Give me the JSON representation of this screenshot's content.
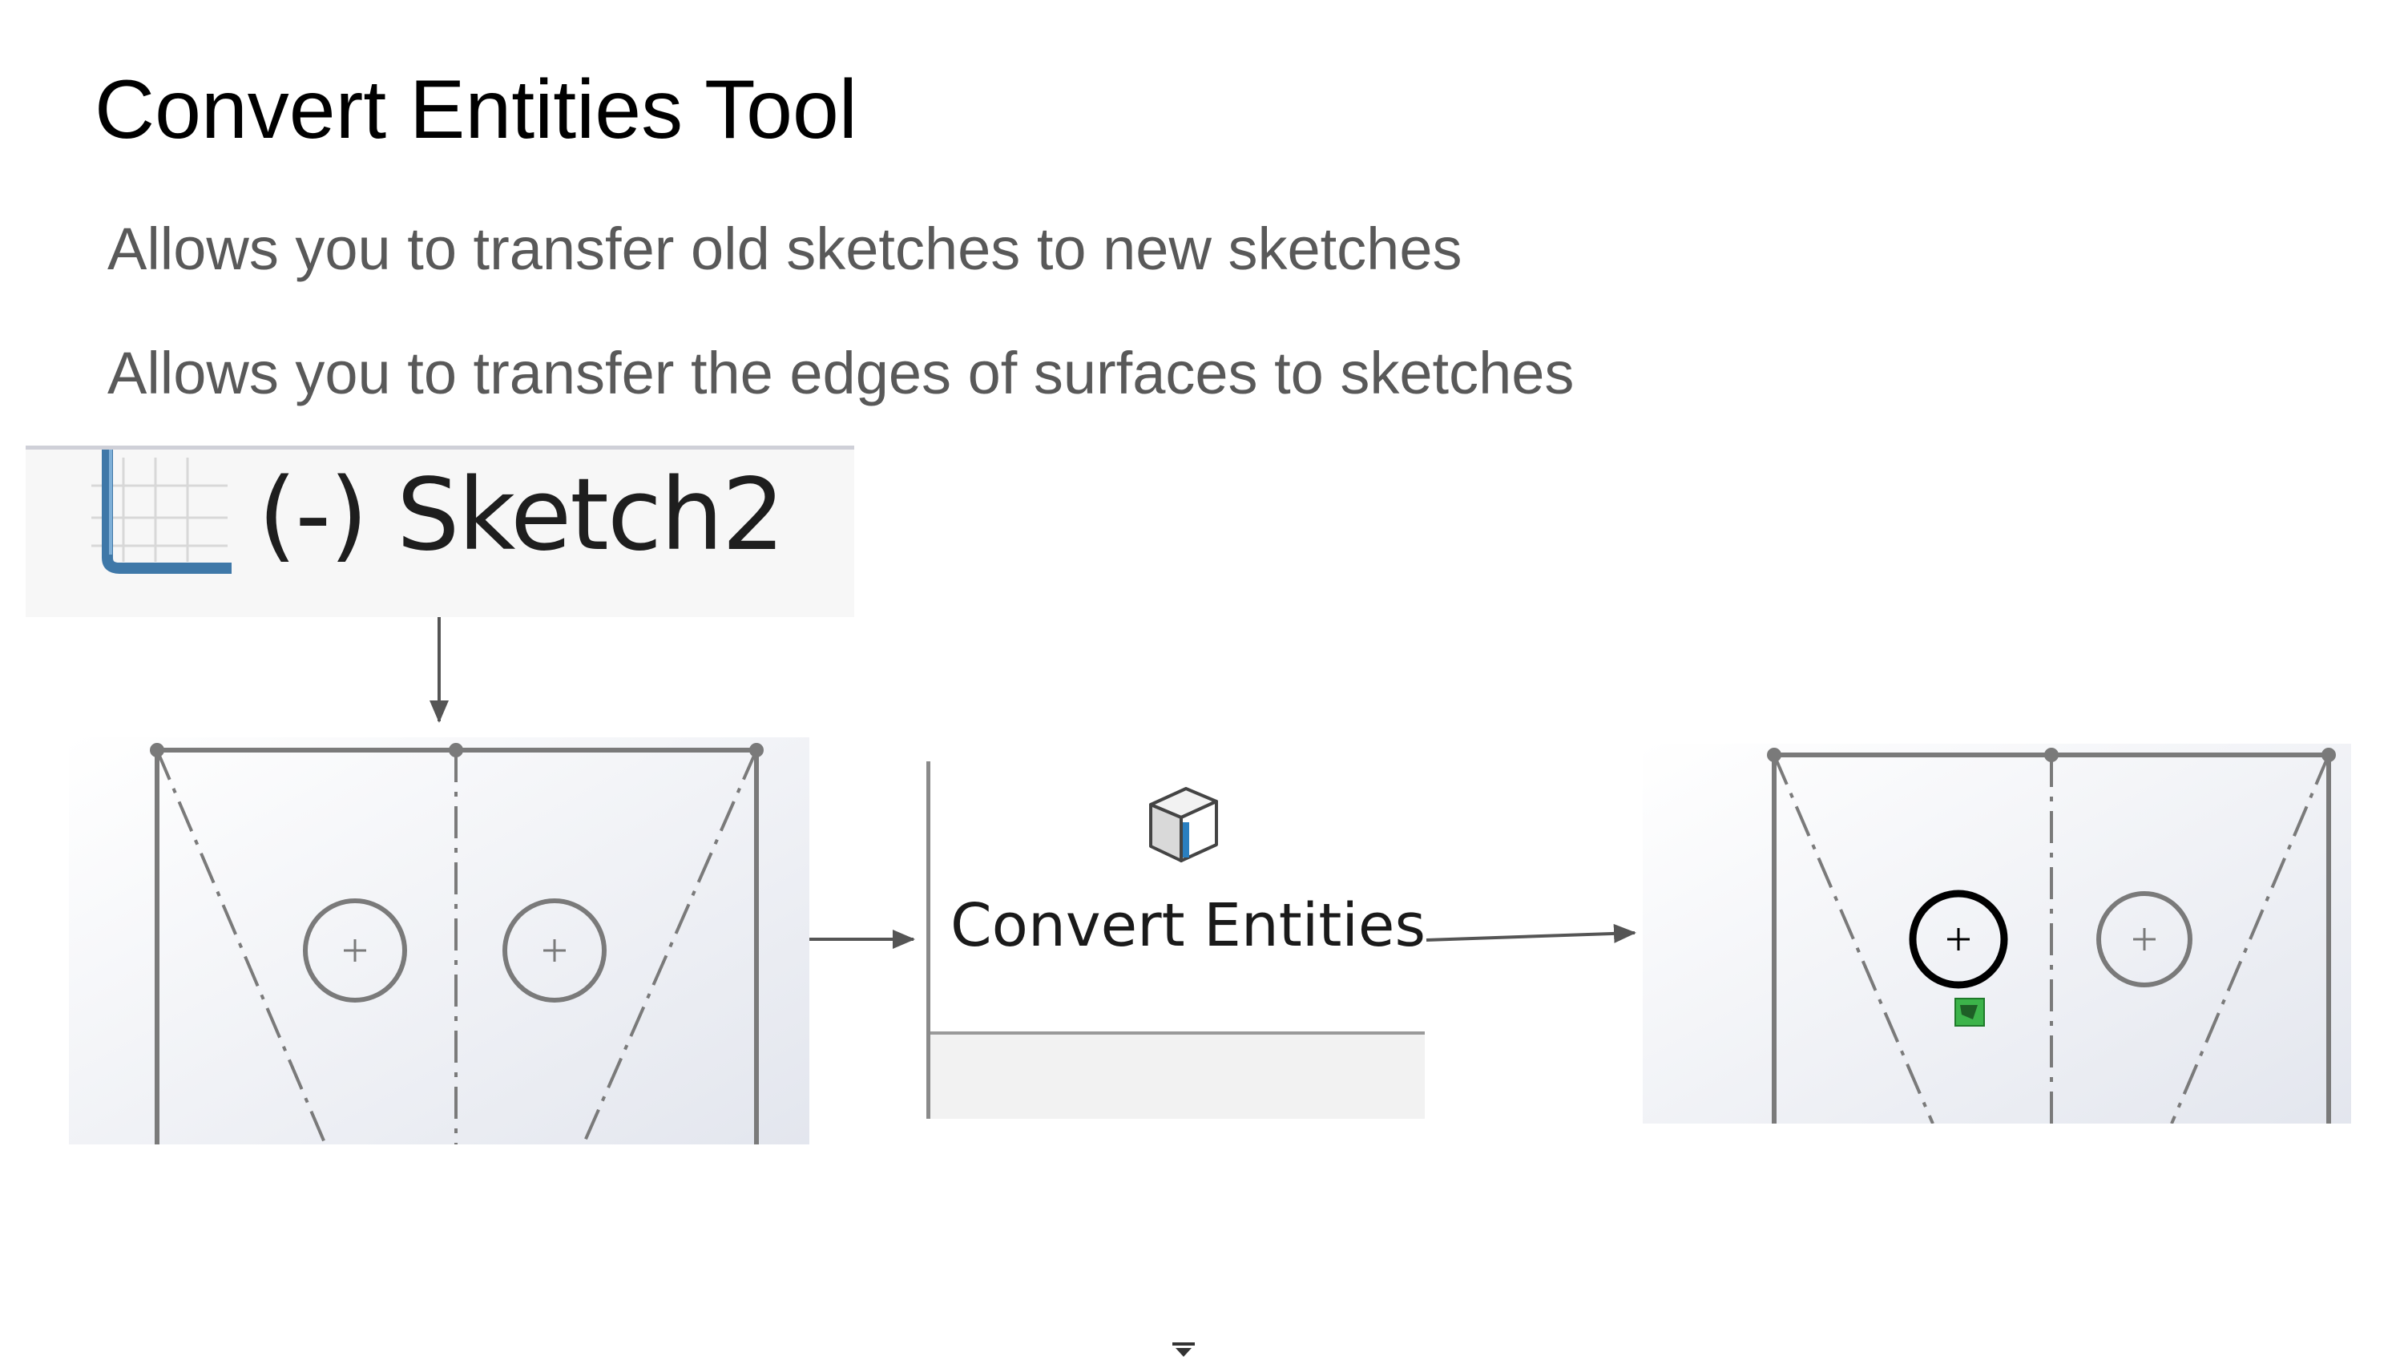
{
  "slide": {
    "title": "Convert Entities Tool",
    "bullets": [
      "Allows you to transfer old sketches to new sketches",
      "Allows you to transfer the edges of surfaces to sketches"
    ]
  },
  "feature_tree": {
    "item_label": "(-) Sketch2",
    "icon": "sketch-icon"
  },
  "toolbar_button": {
    "label": "Convert Entities",
    "icon": "convert-entities-icon",
    "dropdown_icon": "chevron-down-icon"
  },
  "colors": {
    "text_title": "#000000",
    "text_bullet": "#595959",
    "sketch_line": "#7a7a7a",
    "converted_circle": "#000000",
    "relation_badge": "#3cb34a"
  }
}
